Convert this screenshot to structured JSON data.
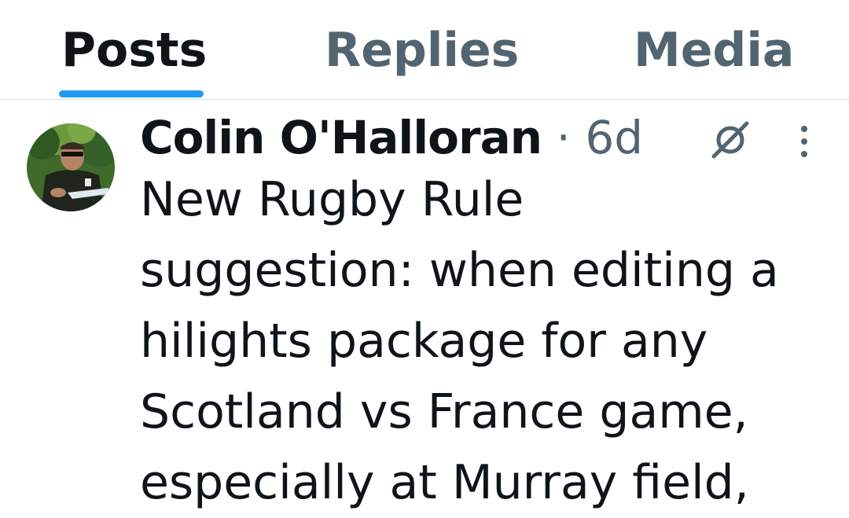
{
  "tabs": [
    {
      "label": "Posts",
      "active": true
    },
    {
      "label": "Replies",
      "active": false
    },
    {
      "label": "Media",
      "active": false
    }
  ],
  "colors": {
    "accent": "#1d9bf0",
    "primary_text": "#0f1419",
    "secondary_text": "#536471",
    "divider": "#e1e6ea"
  },
  "post": {
    "author_name": "Colin O'Halloran",
    "separator": "·",
    "time_ago": "6d",
    "text": "New Rugby Rule\nsuggestion: when editing a\nhilights package for any\nScotland vs France game,\nespecially at Murray field,",
    "avatar_icon": "user-avatar-photo",
    "grok_icon": "grok-slash-icon",
    "more_icon": "more-vertical-icon"
  }
}
